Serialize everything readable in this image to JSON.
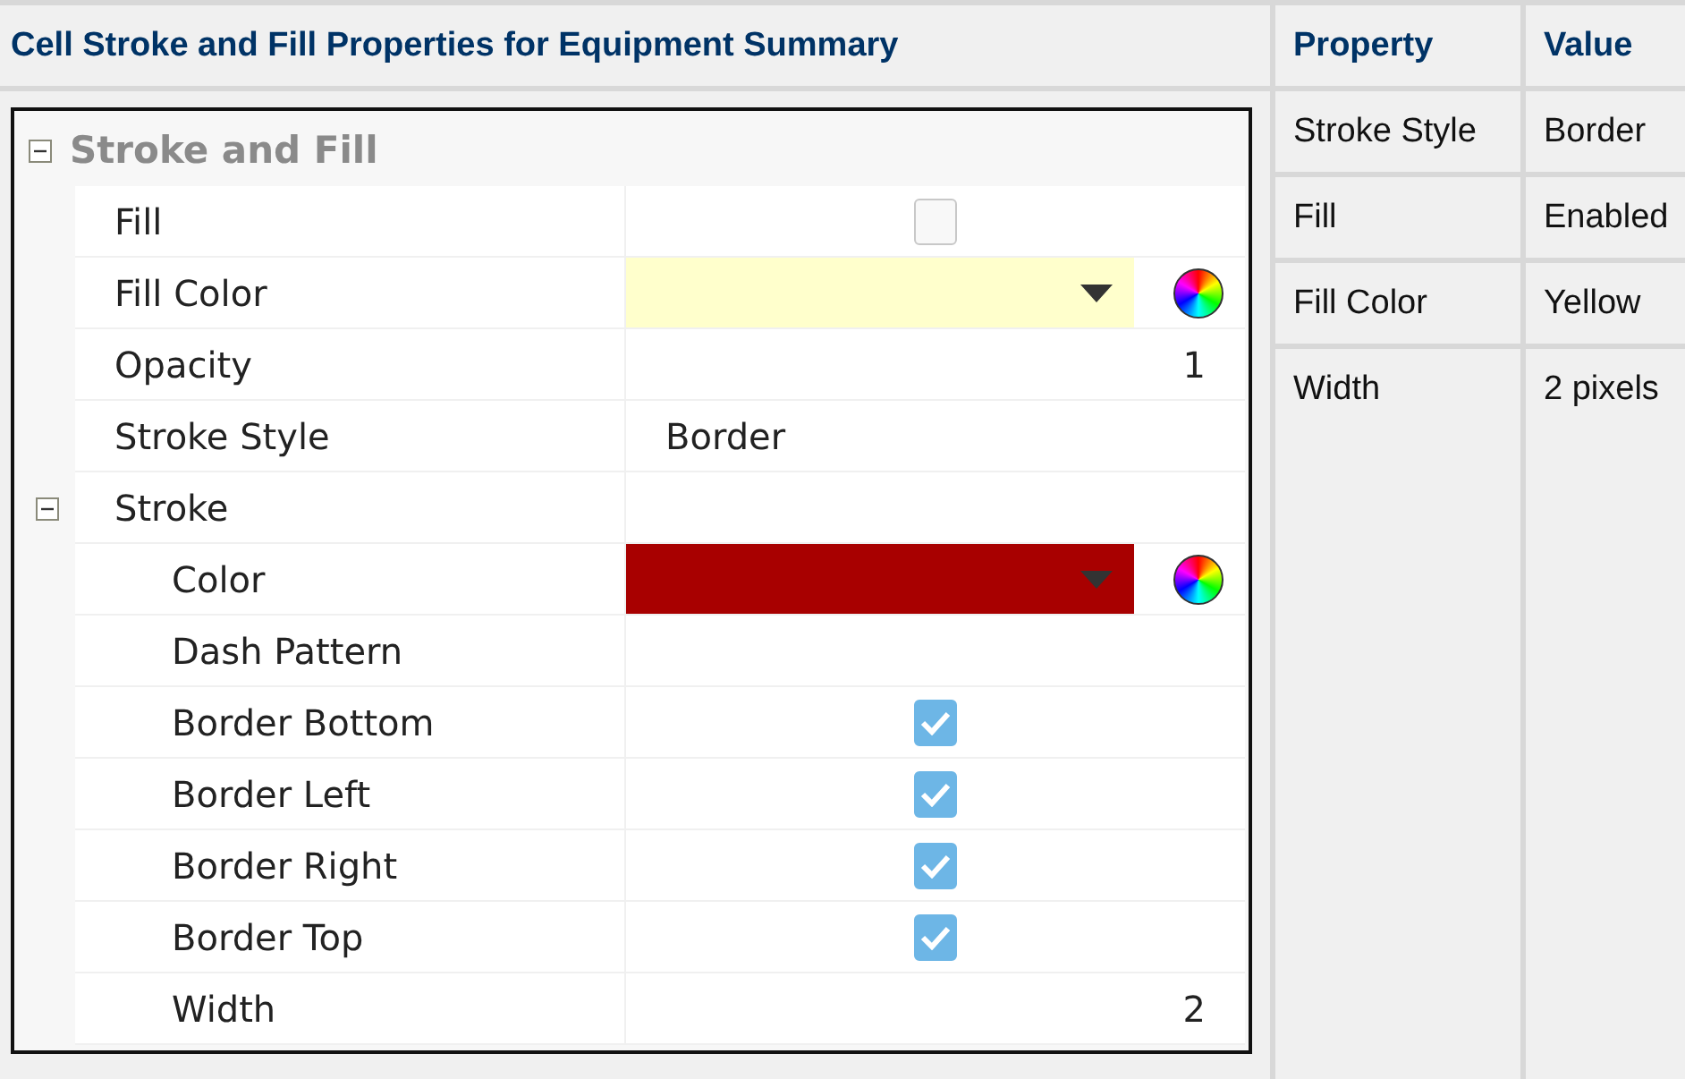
{
  "table": {
    "columns": [
      "Cell Stroke and Fill Properties for Equipment Summary",
      "Property",
      "Value"
    ],
    "rows": [
      {
        "property": "Stroke Style",
        "value": "Border"
      },
      {
        "property": "Fill",
        "value": "Enabled"
      },
      {
        "property": "Fill Color",
        "value": "Yellow"
      },
      {
        "property": "Width",
        "value": "2 pixels"
      }
    ]
  },
  "property_grid": {
    "items": [
      {
        "kind": "group",
        "label": "Stroke and Fill",
        "expanded": true,
        "children": [
          {
            "kind": "checkbox",
            "label": "Fill",
            "checked": false
          },
          {
            "kind": "color",
            "label": "Fill Color",
            "color": "#ffffcc"
          },
          {
            "kind": "number",
            "label": "Opacity",
            "value": "1"
          },
          {
            "kind": "text",
            "label": "Stroke Style",
            "value": "Border"
          },
          {
            "kind": "group",
            "label": "Stroke",
            "expanded": true,
            "children": [
              {
                "kind": "color",
                "label": "Color",
                "color": "#a80000"
              },
              {
                "kind": "text",
                "label": "Dash Pattern"
              },
              {
                "kind": "checkbox",
                "label": "Border Bottom",
                "checked": true
              },
              {
                "kind": "checkbox",
                "label": "Border Left",
                "checked": true
              },
              {
                "kind": "checkbox",
                "label": "Border Right",
                "checked": true
              },
              {
                "kind": "checkbox",
                "label": "Border Top",
                "checked": true
              },
              {
                "kind": "number",
                "label": "Width",
                "value": "2"
              }
            ]
          }
        ]
      }
    ]
  }
}
